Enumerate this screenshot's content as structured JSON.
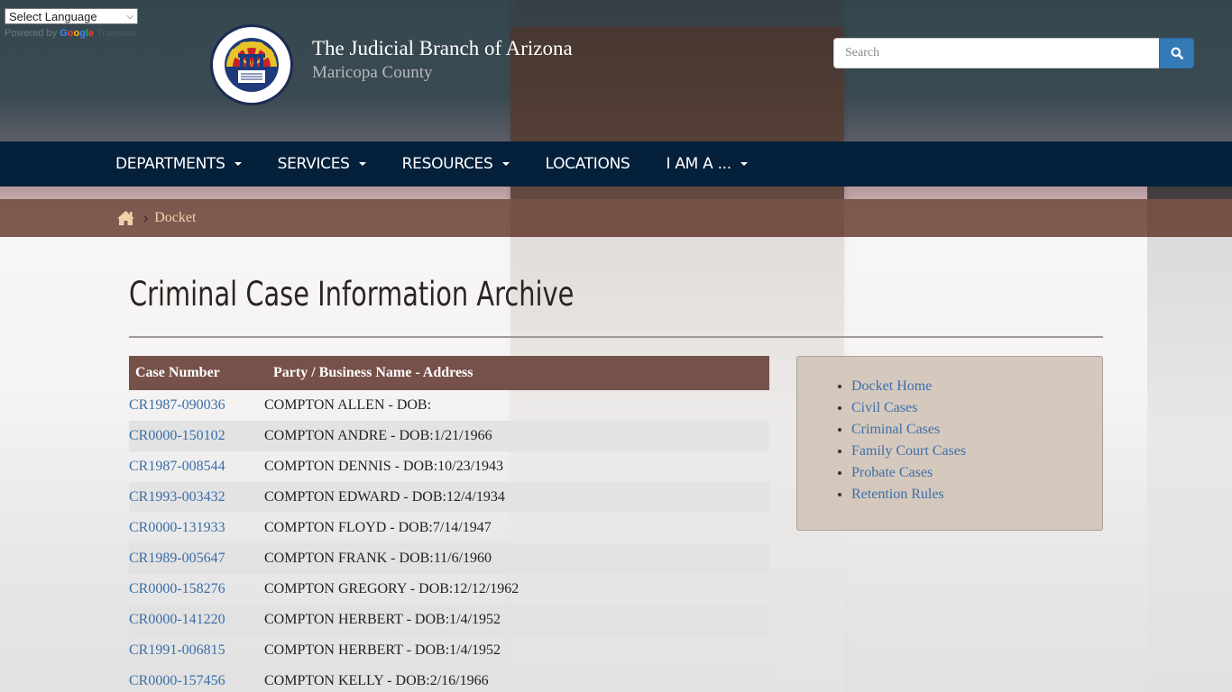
{
  "translate": {
    "select_label": "Select Language",
    "powered_by": "Powered by",
    "google": [
      "G",
      "o",
      "o",
      "g",
      "l",
      "e"
    ],
    "translate_label": "Translate"
  },
  "header": {
    "title": "The Judicial Branch of Arizona",
    "subtitle": "Maricopa County",
    "logo_alt": "The Judicial Branch of Arizona Maricopa County seal"
  },
  "search": {
    "placeholder": "Search",
    "button_icon": "search-icon"
  },
  "nav": {
    "items": [
      {
        "label": "DEPARTMENTS",
        "has_dropdown": true
      },
      {
        "label": "SERVICES",
        "has_dropdown": true
      },
      {
        "label": "RESOURCES",
        "has_dropdown": true
      },
      {
        "label": "LOCATIONS",
        "has_dropdown": false
      },
      {
        "label": "I AM A ...",
        "has_dropdown": true
      }
    ]
  },
  "breadcrumb": {
    "home_icon": "home-icon",
    "current": "Docket"
  },
  "main": {
    "title": "Criminal Case Information Archive",
    "table": {
      "headers": [
        "Case Number",
        "Party / Business Name - Address"
      ],
      "rows": [
        {
          "case": "CR1987-090036",
          "party": "COMPTON ALLEN - DOB:"
        },
        {
          "case": "CR0000-150102",
          "party": "COMPTON ANDRE - DOB:1/21/1966"
        },
        {
          "case": "CR1987-008544",
          "party": "COMPTON DENNIS - DOB:10/23/1943"
        },
        {
          "case": "CR1993-003432",
          "party": "COMPTON EDWARD - DOB:12/4/1934"
        },
        {
          "case": "CR0000-131933",
          "party": "COMPTON FLOYD - DOB:7/14/1947"
        },
        {
          "case": "CR1989-005647",
          "party": "COMPTON FRANK - DOB:11/6/1960"
        },
        {
          "case": "CR0000-158276",
          "party": "COMPTON GREGORY - DOB:12/12/1962"
        },
        {
          "case": "CR0000-141220",
          "party": "COMPTON HERBERT - DOB:1/4/1952"
        },
        {
          "case": "CR1991-006815",
          "party": "COMPTON HERBERT - DOB:1/4/1952"
        },
        {
          "case": "CR0000-157456",
          "party": "COMPTON KELLY - DOB:2/16/1966"
        }
      ]
    }
  },
  "sidebar": {
    "links": [
      {
        "label": "Docket Home"
      },
      {
        "label": "Civil Cases"
      },
      {
        "label": "Criminal Cases"
      },
      {
        "label": "Family Court Cases"
      },
      {
        "label": "Probate Cases"
      },
      {
        "label": "Retention Rules"
      }
    ]
  },
  "colors": {
    "nav_bg": "#04203a",
    "breadcrumb_bg": "#775045",
    "table_header_bg": "#76514a",
    "link": "#3a6ea8",
    "search_button": "#337ab7",
    "sidebar_bg": "#d3c6ba"
  }
}
